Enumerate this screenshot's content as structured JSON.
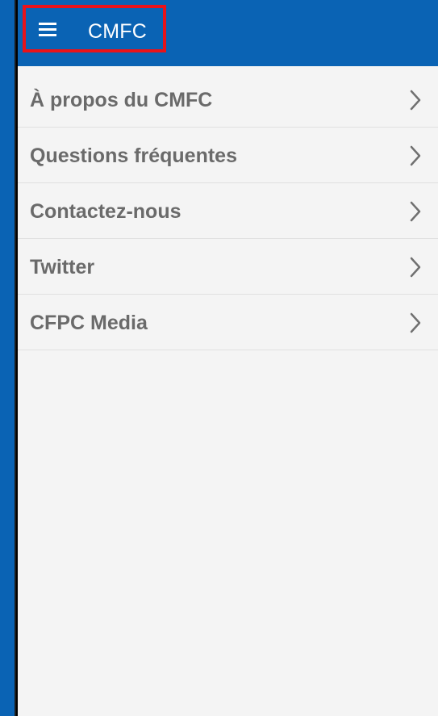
{
  "colors": {
    "primary": "#0a63b4",
    "background": "#f4f4f4",
    "highlight": "#e8131a",
    "label": "#6a6a6a",
    "divider": "#e0e0e0"
  },
  "app_bar": {
    "title": "CMFC",
    "menu_icon": "hamburger-menu-icon"
  },
  "menu": {
    "items": [
      {
        "label": "À propos du CMFC",
        "icon": "chevron-right-icon"
      },
      {
        "label": "Questions fréquentes",
        "icon": "chevron-right-icon"
      },
      {
        "label": "Contactez-nous",
        "icon": "chevron-right-icon"
      },
      {
        "label": "Twitter",
        "icon": "chevron-right-icon"
      },
      {
        "label": "CFPC Media",
        "icon": "chevron-right-icon"
      }
    ]
  }
}
